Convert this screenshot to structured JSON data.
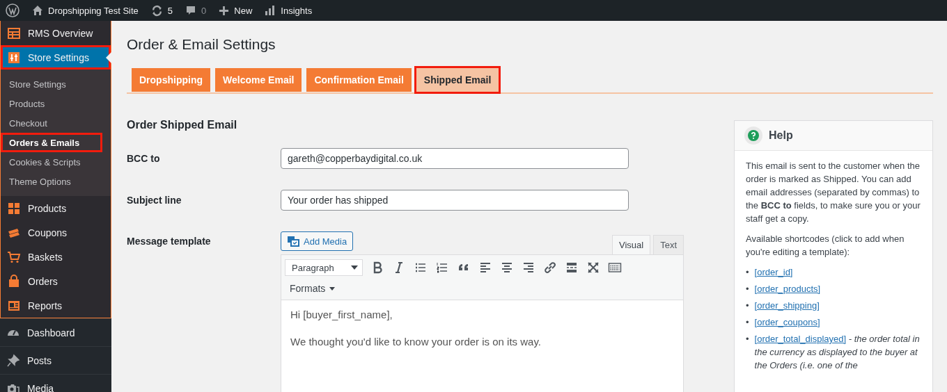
{
  "admin_bar": {
    "site": "Dropshipping Test Site",
    "updates": "5",
    "comments": "0",
    "new": "New",
    "insights": "Insights"
  },
  "sidebar": {
    "plugin_menu": [
      {
        "label": "RMS Overview",
        "selected": false,
        "highlighted": false
      },
      {
        "label": "Store Settings",
        "selected": true,
        "highlighted": true,
        "children": [
          {
            "label": "Store Settings",
            "selected": false,
            "highlighted": false
          },
          {
            "label": "Products",
            "selected": false,
            "highlighted": false
          },
          {
            "label": "Checkout",
            "selected": false,
            "highlighted": false
          },
          {
            "label": "Orders & Emails",
            "selected": true,
            "highlighted": true
          },
          {
            "label": "Cookies & Scripts",
            "selected": false,
            "highlighted": false
          },
          {
            "label": "Theme Options",
            "selected": false,
            "highlighted": false
          }
        ]
      },
      {
        "label": "Products",
        "selected": false,
        "highlighted": false
      },
      {
        "label": "Coupons",
        "selected": false,
        "highlighted": false
      },
      {
        "label": "Baskets",
        "selected": false,
        "highlighted": false
      },
      {
        "label": "Orders",
        "selected": false,
        "highlighted": false
      },
      {
        "label": "Reports",
        "selected": false,
        "highlighted": false
      }
    ],
    "core_menu": [
      {
        "label": "Dashboard"
      },
      {
        "label": "Posts"
      },
      {
        "label": "Media"
      }
    ]
  },
  "page_title": "Order & Email Settings",
  "tabs": [
    {
      "label": "Dropshipping",
      "selected": false,
      "highlighted": false
    },
    {
      "label": "Welcome Email",
      "selected": false,
      "highlighted": false
    },
    {
      "label": "Confirmation Email",
      "selected": false,
      "highlighted": false
    },
    {
      "label": "Shipped Email",
      "selected": true,
      "highlighted": true
    }
  ],
  "section_title": "Order Shipped Email",
  "fields": [
    {
      "label": "BCC to",
      "value": "gareth@copperbaydigital.co.uk"
    },
    {
      "label": "Subject line",
      "value": "Your order has shipped"
    }
  ],
  "editor": {
    "label": "Message template",
    "add_media": "Add Media",
    "tabs": [
      {
        "label": "Visual",
        "selected": true
      },
      {
        "label": "Text",
        "selected": false
      }
    ],
    "format_select": "Paragraph",
    "formats_menu": "Formats",
    "content": [
      "Hi [buyer_first_name],",
      "We thought you'd like to know your order is on its way."
    ]
  },
  "help": {
    "title": "Help",
    "paragraphs": [
      "This email is sent to the customer when the order is marked as Shipped. You can add email addresses (separated by commas) to the **BCC to** fields, to make sure you or your staff get a copy.",
      "Available shortcodes (click to add when you're editing a template):"
    ],
    "shortcodes": [
      {
        "bullet": "•",
        "code": "[order_id]"
      },
      {
        "bullet": "•",
        "code": "[order_products]"
      },
      {
        "bullet": "•",
        "code": "[order_shipping]"
      },
      {
        "bullet": "•",
        "code": "[order_coupons]"
      },
      {
        "bullet": "•",
        "code": "[order_total_displayed]",
        "note": "- the order total in the currency as displayed to the buyer at the Orders (i.e. one of the"
      }
    ]
  }
}
